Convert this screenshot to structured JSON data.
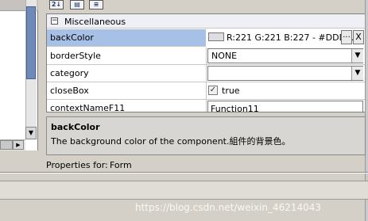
{
  "toolbar": {
    "sort_label": "2↓",
    "cat_label": "▤",
    "desc_label": "≡"
  },
  "grid": {
    "category": {
      "expander": "−",
      "label": "Miscellaneous"
    },
    "rows": [
      {
        "name": "backColor",
        "value": "R:221 G:221 B:227 - #DDD...",
        "dots": "...",
        "clear": "X",
        "swatch": "#dddde3"
      },
      {
        "name": "borderStyle",
        "value": "NONE",
        "arrow": "▼"
      },
      {
        "name": "category",
        "value": "",
        "arrow": "▼"
      },
      {
        "name": "closeBox",
        "value": "true",
        "check": "✓"
      },
      {
        "name": "contextNameF11",
        "value": "Function11"
      }
    ]
  },
  "description": {
    "title": "backColor",
    "text": "The background color of the component.組件的背景色。"
  },
  "footer": {
    "label": "Properties for:",
    "value": "Form"
  },
  "scroll": {
    "down_arrow": "▼",
    "right_arrow": "▶"
  },
  "watermark": "https://blog.csdn.net/weixin_46214043",
  "colors": {
    "selection": "#a7c0e6",
    "scroll_thumb": "#6f89b8",
    "panel": "#d4d0c8"
  }
}
